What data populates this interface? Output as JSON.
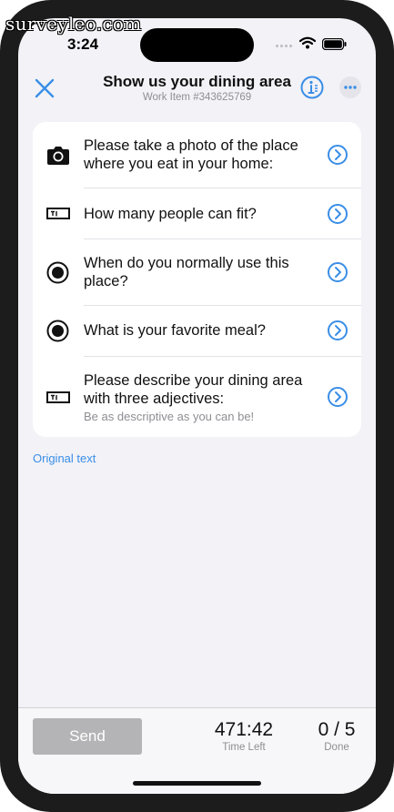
{
  "watermark": "surveyleo.com",
  "status_bar": {
    "time": "3:24"
  },
  "nav": {
    "title": "Show us your dining area",
    "subtitle": "Work Item #343625769"
  },
  "questions": [
    {
      "icon": "camera-icon",
      "text": "Please take a photo of the place where you eat in your home:"
    },
    {
      "icon": "text-field-icon",
      "text": "How many people can fit?"
    },
    {
      "icon": "radio-icon",
      "text": "When do you normally use this place?"
    },
    {
      "icon": "radio-icon",
      "text": "What is your favorite meal?"
    },
    {
      "icon": "text-field-icon",
      "text": "Please describe your dining area with three adjectives:",
      "hint": "Be as descriptive as you can be!"
    }
  ],
  "original_text_link": "Original text",
  "footer": {
    "send_label": "Send",
    "time_left_value": "471:42",
    "time_left_label": "Time Left",
    "done_value": "0 / 5",
    "done_label": "Done"
  },
  "colors": {
    "accent": "#3a8ee6",
    "disabled_button": "#b4b4b6",
    "background": "#f2f2f7"
  }
}
